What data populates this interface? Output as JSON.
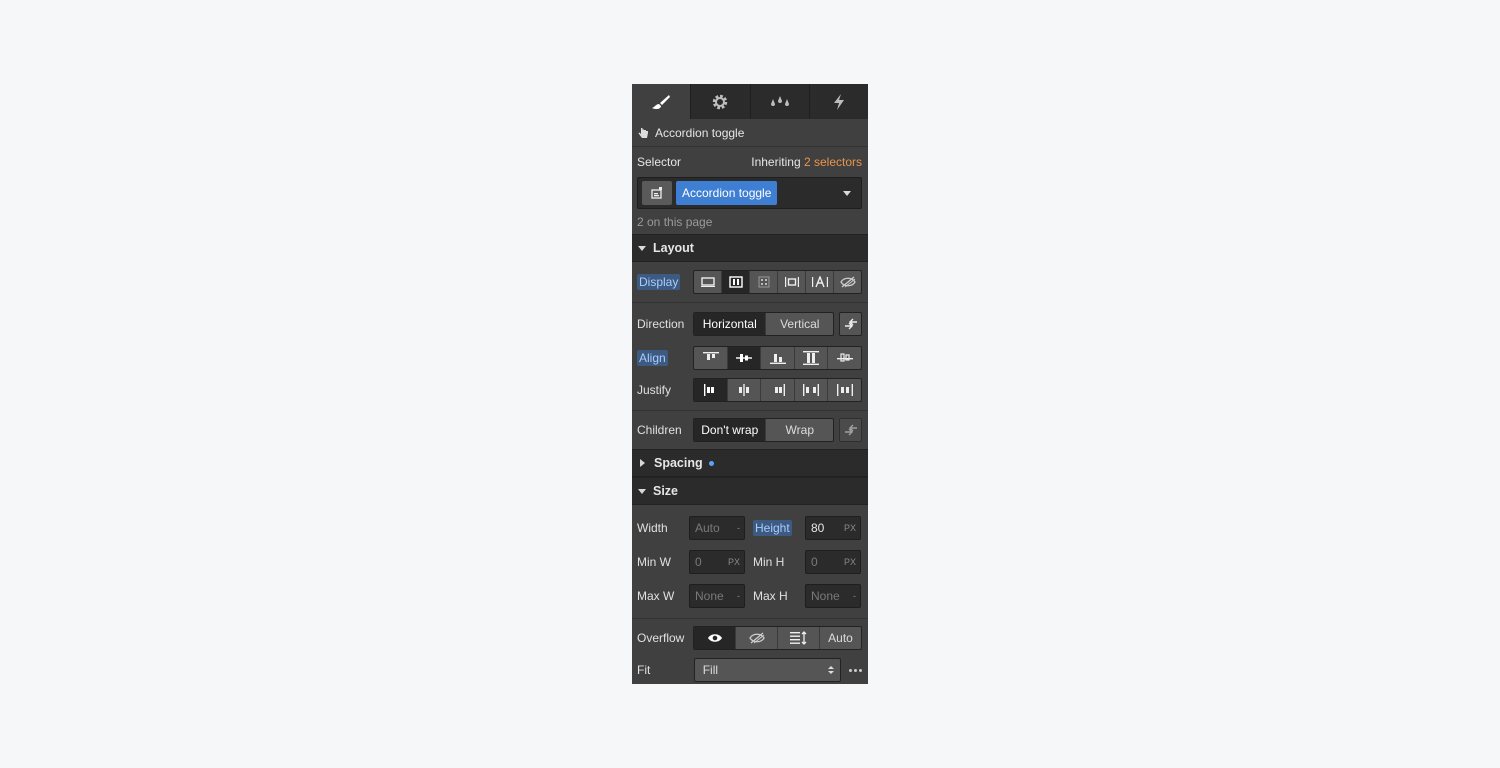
{
  "tabs": [
    {
      "icon": "paintbrush-icon",
      "active": true
    },
    {
      "icon": "gear-icon",
      "active": false
    },
    {
      "icon": "drops-icon",
      "active": false
    },
    {
      "icon": "lightning-icon",
      "active": false
    }
  ],
  "element": {
    "icon": "hand-pointer-icon",
    "name": "Accordion toggle"
  },
  "selector": {
    "label": "Selector",
    "inheriting_prefix": "Inheriting",
    "inheriting_count": "2 selectors",
    "chip": "Accordion toggle",
    "on_page": "2 on this page"
  },
  "layout": {
    "title": "Layout",
    "display_label": "Display",
    "direction_label": "Direction",
    "direction_options": [
      "Horizontal",
      "Vertical"
    ],
    "align_label": "Align",
    "justify_label": "Justify",
    "children_label": "Children",
    "children_options": [
      "Don't wrap",
      "Wrap"
    ]
  },
  "spacing": {
    "title": "Spacing"
  },
  "size": {
    "title": "Size",
    "width_label": "Width",
    "width_value": "Auto",
    "width_unit": "-",
    "height_label": "Height",
    "height_value": "80",
    "height_unit": "PX",
    "minw_label": "Min W",
    "minw_value": "0",
    "minw_unit": "PX",
    "minh_label": "Min H",
    "minh_value": "0",
    "minh_unit": "PX",
    "maxw_label": "Max W",
    "maxw_value": "None",
    "maxw_unit": "-",
    "maxh_label": "Max H",
    "maxh_value": "None",
    "maxh_unit": "-",
    "overflow_label": "Overflow",
    "overflow_auto": "Auto",
    "fit_label": "Fit",
    "fit_value": "Fill"
  },
  "colors": {
    "panel": "#404040",
    "dark": "#2b2b2b",
    "accent": "#3f7fd3",
    "orange": "#e8954b"
  }
}
